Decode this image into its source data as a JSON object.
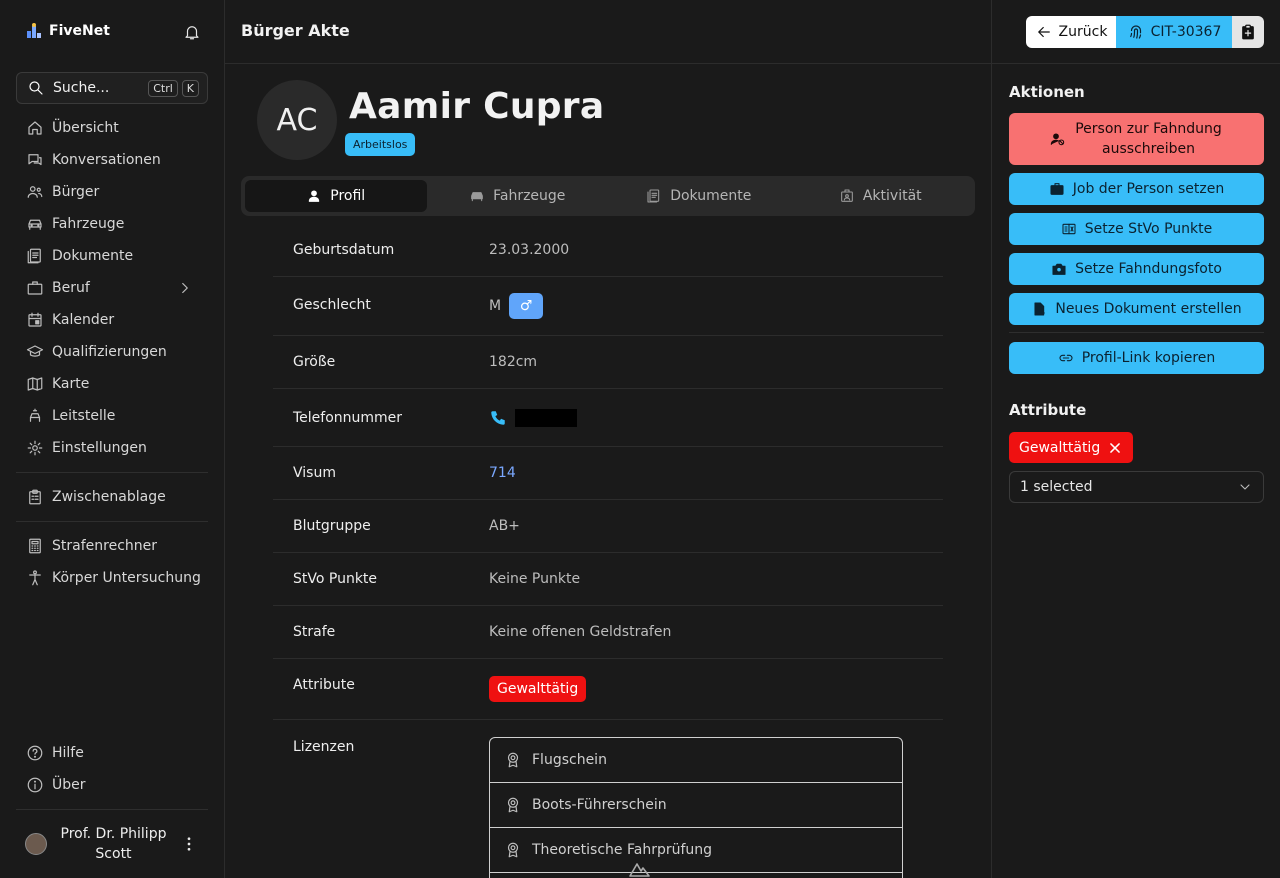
{
  "app": {
    "name": "FiveNet"
  },
  "search": {
    "label": "Suche...",
    "kbd1": "Ctrl",
    "kbd2": "K"
  },
  "nav": [
    {
      "label": "Übersicht",
      "icon": "home-icon"
    },
    {
      "label": "Konversationen",
      "icon": "chat-icon"
    },
    {
      "label": "Bürger",
      "icon": "users-icon"
    },
    {
      "label": "Fahrzeuge",
      "icon": "car-icon"
    },
    {
      "label": "Dokumente",
      "icon": "document-icon"
    },
    {
      "label": "Beruf",
      "icon": "briefcase-icon"
    },
    {
      "label": "Kalender",
      "icon": "calendar-icon"
    },
    {
      "label": "Qualifizierungen",
      "icon": "graduation-icon"
    },
    {
      "label": "Karte",
      "icon": "map-icon"
    },
    {
      "label": "Leitstelle",
      "icon": "dispatch-icon"
    },
    {
      "label": "Einstellungen",
      "icon": "gear-icon"
    }
  ],
  "nav2": [
    {
      "label": "Zwischenablage",
      "icon": "clipboard-icon"
    }
  ],
  "nav3": [
    {
      "label": "Strafenrechner",
      "icon": "calculator-icon"
    },
    {
      "label": "Körper Untersuchung",
      "icon": "person-icon"
    }
  ],
  "nav_bottom": [
    {
      "label": "Hilfe",
      "icon": "help-icon"
    },
    {
      "label": "Über",
      "icon": "info-icon"
    }
  ],
  "user": {
    "name_line1": "Prof. Dr. Philipp",
    "name_line2": "Scott"
  },
  "header": {
    "title": "Bürger Akte",
    "back_label": "Zurück",
    "citizen_id": "CIT-30367"
  },
  "profile": {
    "initials": "AC",
    "name": "Aamir Cupra",
    "job": "Arbeitslos"
  },
  "tabs": [
    {
      "label": "Profil",
      "icon": "user-icon"
    },
    {
      "label": "Fahrzeuge",
      "icon": "car-icon"
    },
    {
      "label": "Dokumente",
      "icon": "document-icon"
    },
    {
      "label": "Aktivität",
      "icon": "activity-icon"
    }
  ],
  "fields": {
    "birth_k": "Geburtsdatum",
    "birth_v": "23.03.2000",
    "gender_k": "Geschlecht",
    "gender_v": "M",
    "gender_symbol": "♂",
    "height_k": "Größe",
    "height_v": "182cm",
    "phone_k": "Telefonnummer",
    "visa_k": "Visum",
    "visa_v": "714",
    "blood_k": "Blutgruppe",
    "blood_v": "AB+",
    "stvo_k": "StVo Punkte",
    "stvo_v": "Keine Punkte",
    "fine_k": "Strafe",
    "fine_v": "Keine offenen Geldstrafen",
    "attr_k": "Attribute",
    "attr_v": "Gewalttätig",
    "lic_k": "Lizenzen"
  },
  "licenses": [
    "Flugschein",
    "Boots-Führerschein",
    "Theoretische Fahrprüfung"
  ],
  "actions": {
    "title": "Aktionen",
    "wanted": "Person zur Fahndung ausschreiben",
    "job": "Job der Person setzen",
    "stvo": "Setze StVo Punkte",
    "photo": "Setze Fahndungsfoto",
    "doc": "Neues Dokument erstellen",
    "link": "Profil-Link kopieren"
  },
  "attributes": {
    "title": "Attribute",
    "chip": "Gewalttätig",
    "select": "1 selected"
  },
  "colors": {
    "accent": "#38bdf8",
    "danger": "#f87171",
    "badge_red": "#ef1111",
    "gender": "#60a5fa"
  }
}
